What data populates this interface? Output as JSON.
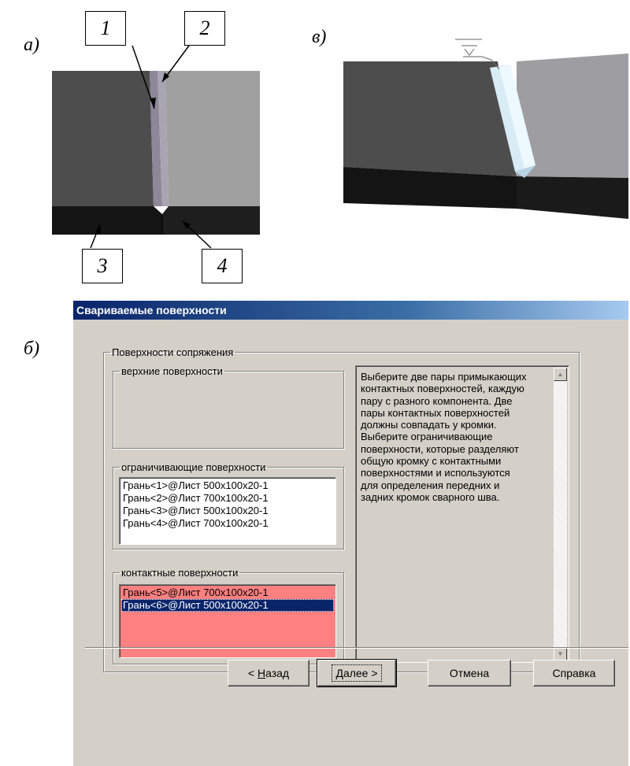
{
  "figure_labels": {
    "a": "а)",
    "b": "б)",
    "v": "в)"
  },
  "callouts": [
    "1",
    "2",
    "3",
    "4"
  ],
  "dialog": {
    "title": "Свариваемые поверхности",
    "mating_group": "Поверхности сопряжения",
    "top_group": "верхние поверхности",
    "bounding_group": "ограничивающие поверхности",
    "bounding_items": [
      "Грань<1>@Лист 500x100x20-1",
      "Грань<2>@Лист 700x100x20-1",
      "Грань<3>@Лист 500x100x20-1",
      "Грань<4>@Лист 700x100x20-1"
    ],
    "contact_group": "контактные поверхности",
    "contact_items": [
      "Грань<5>@Лист 700x100x20-1",
      "Грань<6>@Лист 500x100x20-1"
    ],
    "contact_selected_index": 1,
    "help_text": "Выберите две пары примыкающих контактных поверхностей, каждую пару с разного компонента. Две пары контактных поверхностей должны совпадать у кромки. Выберите ограничивающие поверхности, которые разделяют общую кромку с контактными поверхностями и используются для определения передних и задних кромок сварного шва.",
    "buttons": {
      "back_prefix": "< ",
      "back_mnemonic": "Н",
      "back_rest": "азад",
      "next_mnemonic": "Д",
      "next_rest": "алее >",
      "cancel": "Отмена",
      "help": "Справка"
    },
    "colors": {
      "contact_bg": "#ff8080",
      "selection": "#0a246a"
    }
  }
}
